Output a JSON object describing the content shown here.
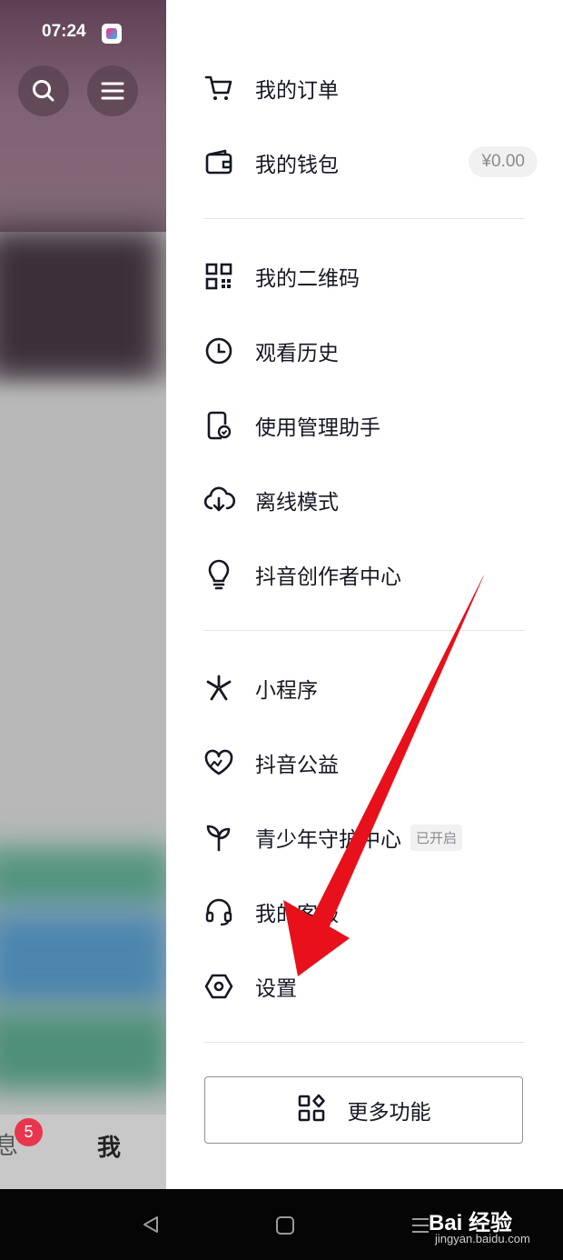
{
  "status_bar": {
    "time": "07:24"
  },
  "left_panel": {
    "tabs": {
      "messages_label": "息",
      "messages_badge": "5",
      "me_label": "我"
    }
  },
  "drawer": {
    "items": [
      {
        "label": "我的订单",
        "icon": "cart-icon"
      },
      {
        "label": "我的钱包",
        "icon": "wallet-icon",
        "value": "¥0.00"
      },
      {
        "label": "我的二维码",
        "icon": "qr-code-icon"
      },
      {
        "label": "观看历史",
        "icon": "clock-icon"
      },
      {
        "label": "使用管理助手",
        "icon": "phone-check-icon"
      },
      {
        "label": "离线模式",
        "icon": "cloud-download-icon"
      },
      {
        "label": "抖音创作者中心",
        "icon": "lightbulb-icon"
      },
      {
        "label": "小程序",
        "icon": "mini-program-icon"
      },
      {
        "label": "抖音公益",
        "icon": "heart-charity-icon"
      },
      {
        "label": "青少年守护中心",
        "icon": "sprout-icon",
        "tag": "已开启"
      },
      {
        "label": "我的客服",
        "icon": "headset-icon"
      },
      {
        "label": "设置",
        "icon": "settings-hexagon-icon"
      }
    ],
    "more_button": {
      "label": "更多功能",
      "icon": "grid-shapes-icon"
    }
  },
  "watermark": {
    "logo": "Bai 经验",
    "url": "jingyan.baidu.com"
  },
  "colors": {
    "accent_red": "#e8364e",
    "arrow_red": "#e8101a",
    "text": "#161823"
  }
}
